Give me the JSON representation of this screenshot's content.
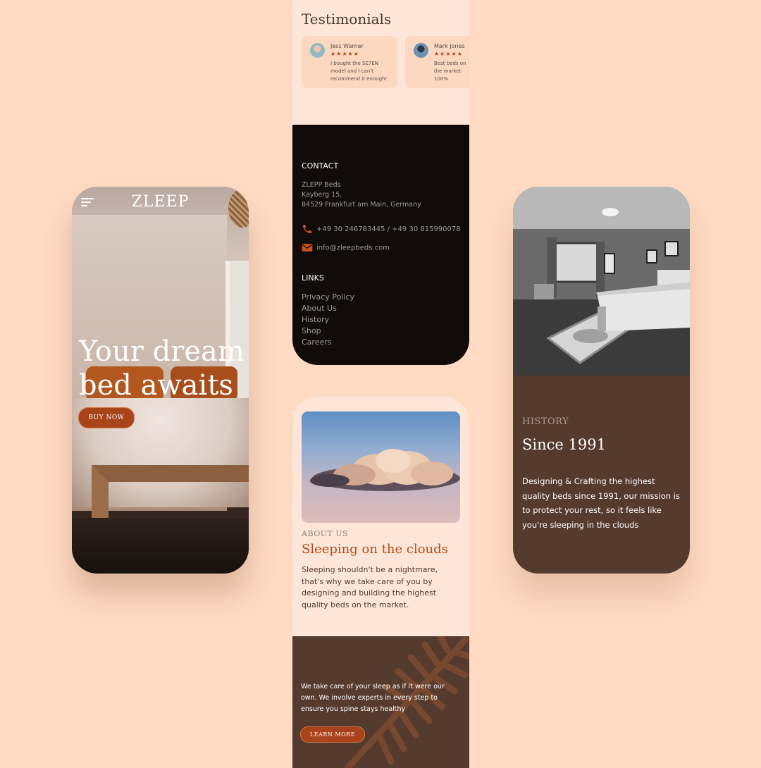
{
  "colors": {
    "background": "#ffdbc4",
    "accent": "#a9431a",
    "dark_brown": "#553a2e",
    "footer_black": "#110b09",
    "cream": "#fde6d7"
  },
  "hero": {
    "logo": "ZLEEP",
    "menu_icon": "hamburger-menu-icon",
    "headline": "Your dream bed awaits",
    "buy_button": "BUY NOW"
  },
  "testimonials": {
    "title": "Testimonials",
    "items": [
      {
        "name": "Jess Warner",
        "rating": 5,
        "stars": "★★★★★",
        "text": "I bought the SE7EN model and I can't recommend it enough!"
      },
      {
        "name": "Mark Jones",
        "rating": 5,
        "stars": "★★★★★",
        "text": "Best beds on the market 100%"
      }
    ]
  },
  "contact": {
    "heading": "CONTACT",
    "company": "ZLEPP Beds",
    "street": "Kayberg 15,",
    "city": "84529 Frankfurt am Main, Germany",
    "phone": "+49 30 246783445 / +49 30 815990078",
    "phone_icon": "phone-icon",
    "email": "info@zleepbeds.com",
    "email_icon": "mail-icon"
  },
  "links": {
    "heading": "LINKS",
    "items": [
      "Privacy Policy",
      "About Us",
      "History",
      "Shop",
      "Careers"
    ]
  },
  "about": {
    "overline": "ABOUT US",
    "heading": "Sleeping on the clouds",
    "body": "Sleeping shouldn't be a nightmare, that's why we take care of you by designing and building the highest quality beds on the market.",
    "care_text": "We take care of your sleep as if it were our own. We involve experts in every step to ensure you spine stays healthy",
    "learn_button": "LEARN MORE"
  },
  "history": {
    "overline": "HISTORY",
    "heading": "Since 1991",
    "body": "Designing & Crafting the highest quality beds since 1991, our mission is to protect your rest, so it feels like you're sleeping in the clouds"
  }
}
